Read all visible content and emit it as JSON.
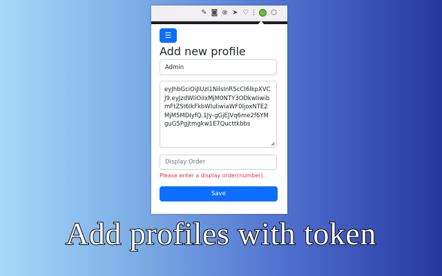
{
  "toolbar": {
    "icons": [
      "edit-icon",
      "camera-icon",
      "shield-x-icon",
      "send-icon",
      "heart-icon",
      "extension-icon",
      "puzzle-icon"
    ]
  },
  "popup": {
    "menu_icon": "list-icon",
    "title": "Add new profile",
    "name_value": "Admin",
    "token_value": "eyJhbGciOiJIUzI1NiIsInR5cCI6IkpXVCJ9.eyJzdWIiOiIxMjM0NTY3ODkwIiwibmFtZSI6IkFkbWluIiwiaWF0IjoxNTE2MjM5MDIyfQ.1Jy-gGjEJVq6me2f6YMguG5Pgjtmgkw1E7Qucttkbbs",
    "order_placeholder": "Display Order",
    "error_text": "Please enter a display order(number).",
    "save_label": "Save"
  },
  "caption": "Add profiles with token",
  "colors": {
    "primary": "#0d6efd",
    "error": "#dc3545"
  }
}
